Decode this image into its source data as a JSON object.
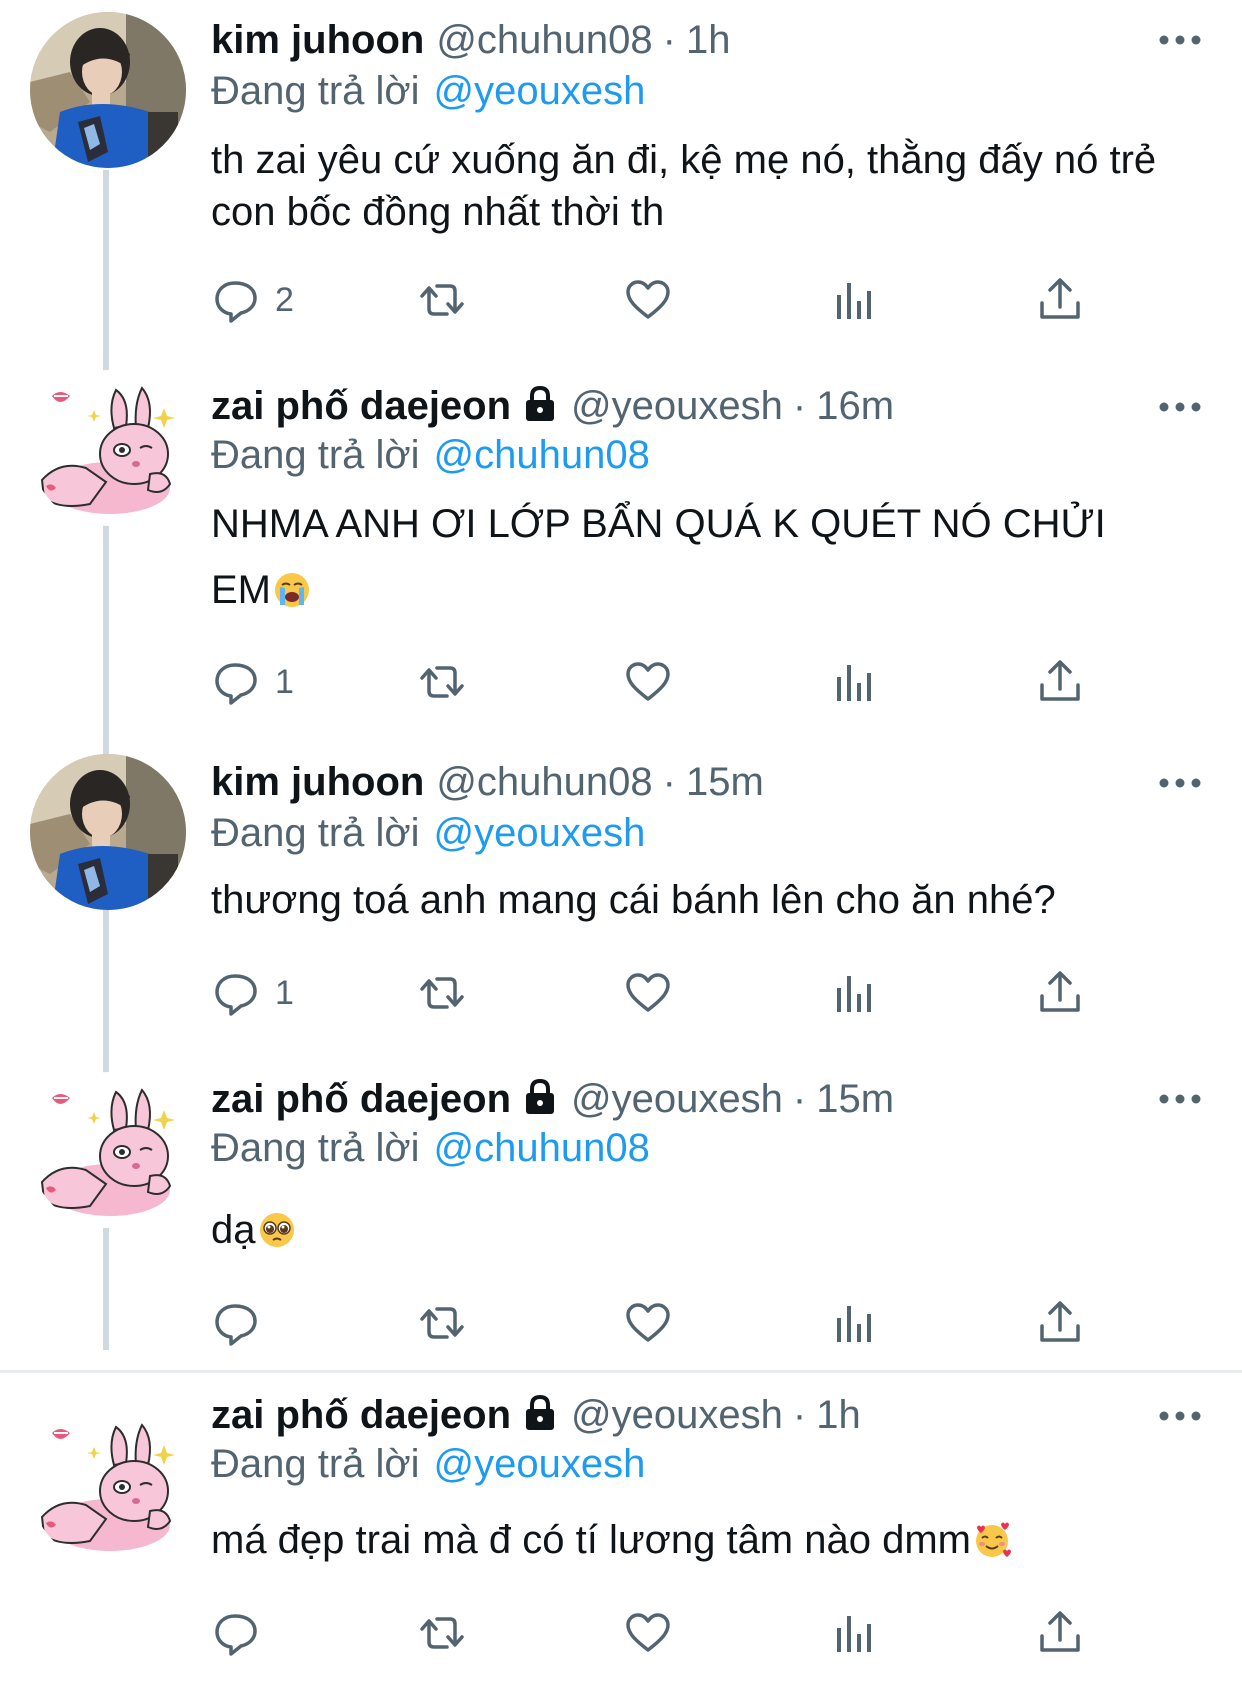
{
  "colors": {
    "text": "#0f1419",
    "muted": "#536471",
    "link": "#1d9bf0",
    "thread_line": "#cfd9de"
  },
  "icons": {
    "reply": "speech-bubble-icon",
    "retweet": "retweet-arrows-icon",
    "like": "heart-icon",
    "views": "bar-chart-icon",
    "share": "share-upload-icon",
    "more": "more-dots-icon",
    "protected": "lock-icon"
  },
  "tweets": [
    {
      "name": "kim juhoon",
      "handle": "@chuhun08",
      "separator": "·",
      "time": "1h",
      "replying_label": "Đang trả lời",
      "replying_to": "@yeouxesh",
      "text": "th zai yêu cứ xuống ăn đi, kệ mẹ nó, thằng đấy nó trẻ con bốc đồng nhất thời th",
      "emoji": "",
      "reply_count": "2"
    },
    {
      "name": "zai phố daejeon",
      "handle": "@yeouxesh",
      "separator": "·",
      "time": "16m",
      "replying_label": "Đang trả lời",
      "replying_to": "@chuhun08",
      "text": "NHMA ANH ƠI LỚP BẨN QUÁ K QUÉT NÓ CHỬI EM",
      "emoji": "loudly-crying-face-emoji",
      "reply_count": "1"
    },
    {
      "name": "kim juhoon",
      "handle": "@chuhun08",
      "separator": "·",
      "time": "15m",
      "replying_label": "Đang trả lời",
      "replying_to": "@yeouxesh",
      "text": "thương toá anh mang cái bánh lên cho ăn nhé?",
      "emoji": "",
      "reply_count": "1"
    },
    {
      "name": "zai phố daejeon",
      "handle": "@yeouxesh",
      "separator": "·",
      "time": "15m",
      "replying_label": "Đang trả lời",
      "replying_to": "@chuhun08",
      "text": "dạ",
      "emoji": "pleading-face-emoji",
      "reply_count": ""
    },
    {
      "name": "zai phố daejeon",
      "handle": "@yeouxesh",
      "separator": "·",
      "time": "1h",
      "replying_label": "Đang trả lời",
      "replying_to": "@yeouxesh",
      "text": "má đẹp trai mà đ có tí lương tâm nào dmm",
      "emoji": "smiling-face-with-hearts-emoji",
      "reply_count": ""
    }
  ]
}
